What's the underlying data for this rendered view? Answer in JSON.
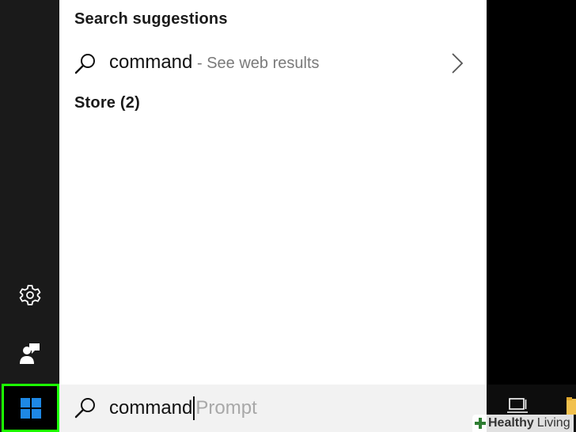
{
  "search_results": {
    "suggestions_heading": "Search suggestions",
    "suggestion": {
      "query": "command",
      "hint": "- See web results"
    },
    "store_heading": "Store (2)"
  },
  "search_box": {
    "typed_text": "command",
    "autocomplete_text": "Prompt"
  },
  "left_rail": {
    "icons": [
      "gear-icon",
      "feedback-icon",
      "windows-logo-icon"
    ]
  },
  "taskbar": {
    "icons": [
      "task-view-icon",
      "folder-icon"
    ]
  },
  "watermark": {
    "bold": "Healthy",
    "normal": "Living"
  },
  "colors": {
    "start_highlight": "#1cff00",
    "windows_logo": "#1e88e5",
    "panel_bg": "#ffffff",
    "search_bar_bg": "#f2f2f2",
    "rail_bg": "#1a1a1a"
  }
}
